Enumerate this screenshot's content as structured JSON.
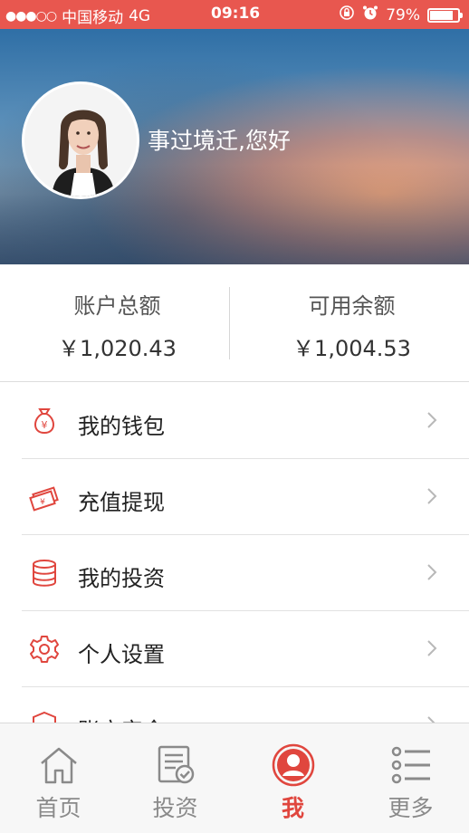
{
  "status_bar": {
    "signal": "●●●○○",
    "carrier": "中国移动",
    "network": "4G",
    "time": "09:16",
    "battery_percent": "79%",
    "battery_level": 0.79
  },
  "header": {
    "greeting": "事过境迁,您好"
  },
  "balance": {
    "total_label": "账户总额",
    "total_value": "￥1,020.43",
    "available_label": "可用余额",
    "available_value": "￥1,004.53"
  },
  "menu": {
    "items": [
      {
        "label": "我的钱包",
        "icon": "money-bag-icon"
      },
      {
        "label": "充值提现",
        "icon": "cash-notes-icon"
      },
      {
        "label": "我的投资",
        "icon": "database-stack-icon"
      },
      {
        "label": "个人设置",
        "icon": "gear-icon"
      },
      {
        "label": "账户安全",
        "icon": "shield-icon"
      }
    ]
  },
  "tabs": [
    {
      "label": "首页",
      "icon": "home-icon",
      "active": false
    },
    {
      "label": "投资",
      "icon": "document-check-icon",
      "active": false
    },
    {
      "label": "我",
      "icon": "user-profile-icon",
      "active": true
    },
    {
      "label": "更多",
      "icon": "list-icon",
      "active": false
    }
  ],
  "colors": {
    "accent": "#e0463e",
    "status_bar": "#e8574f",
    "inactive": "#8a8a8a"
  }
}
